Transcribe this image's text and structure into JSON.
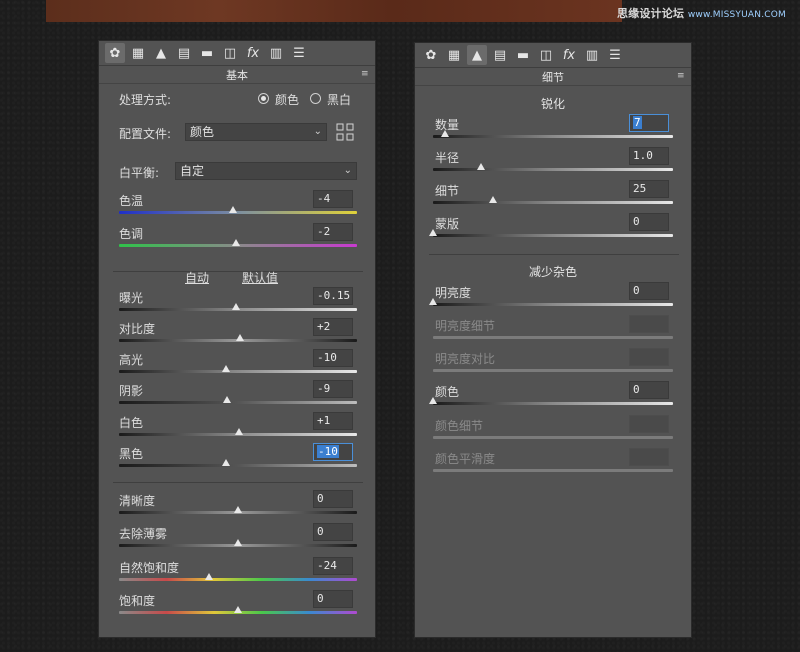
{
  "watermark": {
    "main": "思缘设计论坛",
    "sub": "www.MISSYUAN.COM"
  },
  "left_panel": {
    "tools": [
      "aperture-icon",
      "histogram-icon",
      "tone-curve-icon",
      "hsl-icon",
      "split-tone-icon",
      "lens-icon",
      "fx-icon",
      "camera-calibration-icon",
      "presets-icon"
    ],
    "header": "基本",
    "treatment": {
      "label": "处理方式:",
      "color": "颜色",
      "bw": "黑白",
      "selected": "颜色"
    },
    "profile": {
      "label": "配置文件:",
      "value": "颜色"
    },
    "white_balance": {
      "label": "白平衡:",
      "value": "自定"
    },
    "temp": {
      "label": "色温",
      "value": "-4",
      "level": 0.48
    },
    "tint": {
      "label": "色调",
      "value": "-2",
      "level": 0.49
    },
    "auto": "自动",
    "default": "默认值",
    "exposure": {
      "label": "曝光",
      "value": "-0.15",
      "level": 0.49
    },
    "contrast": {
      "label": "对比度",
      "value": "+2",
      "level": 0.51
    },
    "highlights": {
      "label": "高光",
      "value": "-10",
      "level": 0.45
    },
    "shadows": {
      "label": "阴影",
      "value": "-9",
      "level": 0.455
    },
    "whites": {
      "label": "白色",
      "value": "+1",
      "level": 0.505
    },
    "blacks": {
      "label": "黑色",
      "value": "-10",
      "level": 0.45
    },
    "clarity": {
      "label": "清晰度",
      "value": "0",
      "level": 0.5
    },
    "dehaze": {
      "label": "去除薄雾",
      "value": "0",
      "level": 0.5
    },
    "vibrance": {
      "label": "自然饱和度",
      "value": "-24",
      "level": 0.38
    },
    "saturation": {
      "label": "饱和度",
      "value": "0",
      "level": 0.5
    }
  },
  "right_panel": {
    "header": "细节",
    "sharpening": {
      "title": "锐化",
      "amount": {
        "label": "数量",
        "value": "7",
        "level": 0.05
      },
      "radius": {
        "label": "半径",
        "value": "1.0",
        "level": 0.2
      },
      "detail": {
        "label": "细节",
        "value": "25",
        "level": 0.25
      },
      "masking": {
        "label": "蒙版",
        "value": "0",
        "level": 0.0
      }
    },
    "noise": {
      "title": "减少杂色",
      "luminance": {
        "label": "明亮度",
        "value": "0",
        "level": 0.0
      },
      "lum_detail": {
        "label": "明亮度细节"
      },
      "lum_contrast": {
        "label": "明亮度对比"
      },
      "color": {
        "label": "颜色",
        "value": "0",
        "level": 0.0
      },
      "color_detail": {
        "label": "颜色细节"
      },
      "color_smooth": {
        "label": "颜色平滑度"
      }
    }
  }
}
